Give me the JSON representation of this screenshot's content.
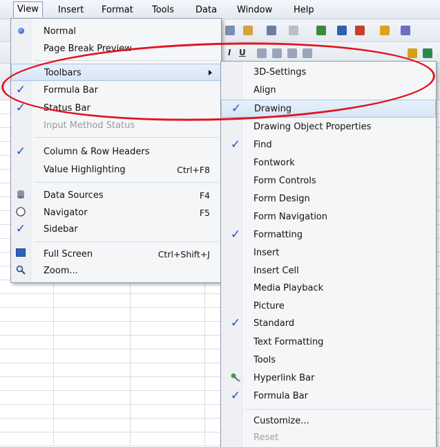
{
  "menubar": {
    "items": [
      "View",
      "Insert",
      "Format",
      "Tools",
      "Data",
      "Window",
      "Help"
    ]
  },
  "view_menu": {
    "items": [
      {
        "label": "Normal",
        "shortcut": "",
        "icon": "radio-dot-icon",
        "state": "selected"
      },
      {
        "label": "Page Break Preview",
        "shortcut": "",
        "icon": "",
        "state": ""
      },
      {
        "label": "Toolbars",
        "shortcut": "",
        "icon": "submenu-arrow-icon",
        "state": "highlighted"
      },
      {
        "label": "Formula Bar",
        "shortcut": "",
        "icon": "checkmark-icon",
        "state": "checked"
      },
      {
        "label": "Status Bar",
        "shortcut": "",
        "icon": "checkmark-icon",
        "state": "checked"
      },
      {
        "label": "Input Method Status",
        "shortcut": "",
        "icon": "",
        "state": "disabled"
      },
      {
        "label": "Column & Row Headers",
        "shortcut": "",
        "icon": "checkmark-icon",
        "state": "checked"
      },
      {
        "label": "Value Highlighting",
        "shortcut": "Ctrl+F8",
        "icon": "",
        "state": ""
      },
      {
        "label": "Data Sources",
        "shortcut": "F4",
        "icon": "database-icon",
        "state": ""
      },
      {
        "label": "Navigator",
        "shortcut": "F5",
        "icon": "compass-icon",
        "state": ""
      },
      {
        "label": "Sidebar",
        "shortcut": "",
        "icon": "checkmark-icon",
        "state": "checked"
      },
      {
        "label": "Full Screen",
        "shortcut": "Ctrl+Shift+J",
        "icon": "fullscreen-icon",
        "state": ""
      },
      {
        "label": "Zoom...",
        "shortcut": "",
        "icon": "magnifier-icon",
        "state": ""
      }
    ]
  },
  "toolbars_submenu": {
    "items": [
      {
        "label": "3D-Settings",
        "checked": false
      },
      {
        "label": "Align",
        "checked": false
      },
      {
        "label": "Drawing",
        "checked": true,
        "highlighted": true
      },
      {
        "label": "Drawing Object Properties",
        "checked": false
      },
      {
        "label": "Find",
        "checked": true
      },
      {
        "label": "Fontwork",
        "checked": false
      },
      {
        "label": "Form Controls",
        "checked": false
      },
      {
        "label": "Form Design",
        "checked": false
      },
      {
        "label": "Form Navigation",
        "checked": false
      },
      {
        "label": "Formatting",
        "checked": true
      },
      {
        "label": "Insert",
        "checked": false
      },
      {
        "label": "Insert Cell",
        "checked": false
      },
      {
        "label": "Media Playback",
        "checked": false
      },
      {
        "label": "Picture",
        "checked": false
      },
      {
        "label": "Standard",
        "checked": true
      },
      {
        "label": "Text Formatting",
        "checked": false
      },
      {
        "label": "Tools",
        "checked": false
      },
      {
        "label": "Hyperlink Bar",
        "checked": false,
        "icon": "hyperlink-icon"
      },
      {
        "label": "Formula Bar",
        "checked": true
      },
      {
        "label": "Customize...",
        "checked": false
      },
      {
        "label": "Reset",
        "checked": false,
        "disabled": true
      }
    ]
  },
  "colors": {
    "annotation_ellipse": "#e0141e",
    "checkmark": "#1b4fc9",
    "highlight": "#d6e5f6"
  }
}
